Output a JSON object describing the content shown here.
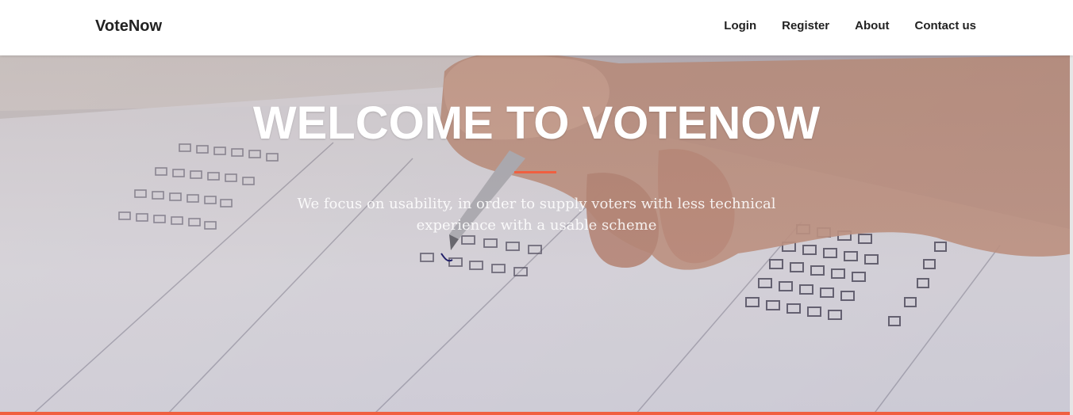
{
  "navbar": {
    "brand": "VoteNow",
    "links": [
      {
        "label": "Login"
      },
      {
        "label": "Register"
      },
      {
        "label": "About"
      },
      {
        "label": "Contact us"
      }
    ]
  },
  "hero": {
    "title": "WELCOME TO VOTENOW",
    "subtitle": "We focus on usability, in order to supply voters with less technical experience with a usable scheme",
    "background": "ballot-paper-hand-pen-photo"
  },
  "colors": {
    "accent": "#f05f40",
    "nav_text": "#222222",
    "hero_text": "#ffffff"
  }
}
